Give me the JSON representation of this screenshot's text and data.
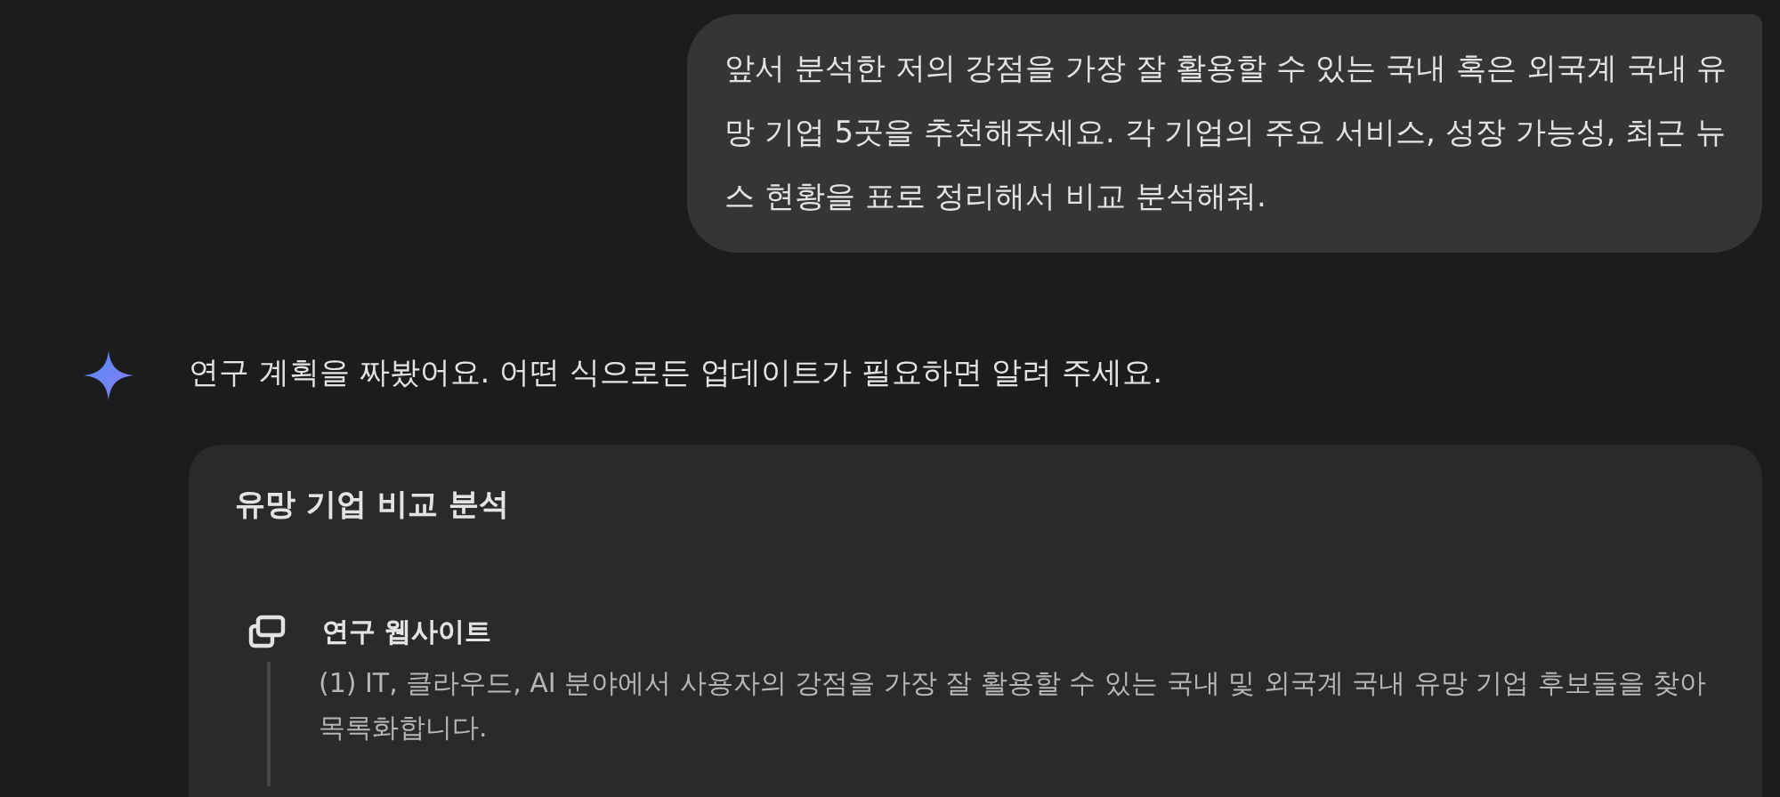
{
  "user_message": "앞서 분석한 저의 강점을 가장 잘 활용할 수 있는 국내 혹은 외국계 국내 유망 기업 5곳을 추천해주세요. 각 기업의 주요 서비스, 성장 가능성, 최근 뉴스 현황을 표로 정리해서 비교 분석해줘.",
  "assistant_message": "연구 계획을 짜봤어요. 어떤 식으로든 업데이트가 필요하면 알려 주세요.",
  "plan": {
    "title": "유망 기업 비교 분석",
    "steps": [
      {
        "label": "연구 웹사이트",
        "description": "(1) IT, 클라우드, AI 분야에서 사용자의 강점을 가장 잘 활용할 수 있는 국내 및 외국계 국내 유망 기업 후보들을 찾아 목록화합니다."
      }
    ]
  }
}
